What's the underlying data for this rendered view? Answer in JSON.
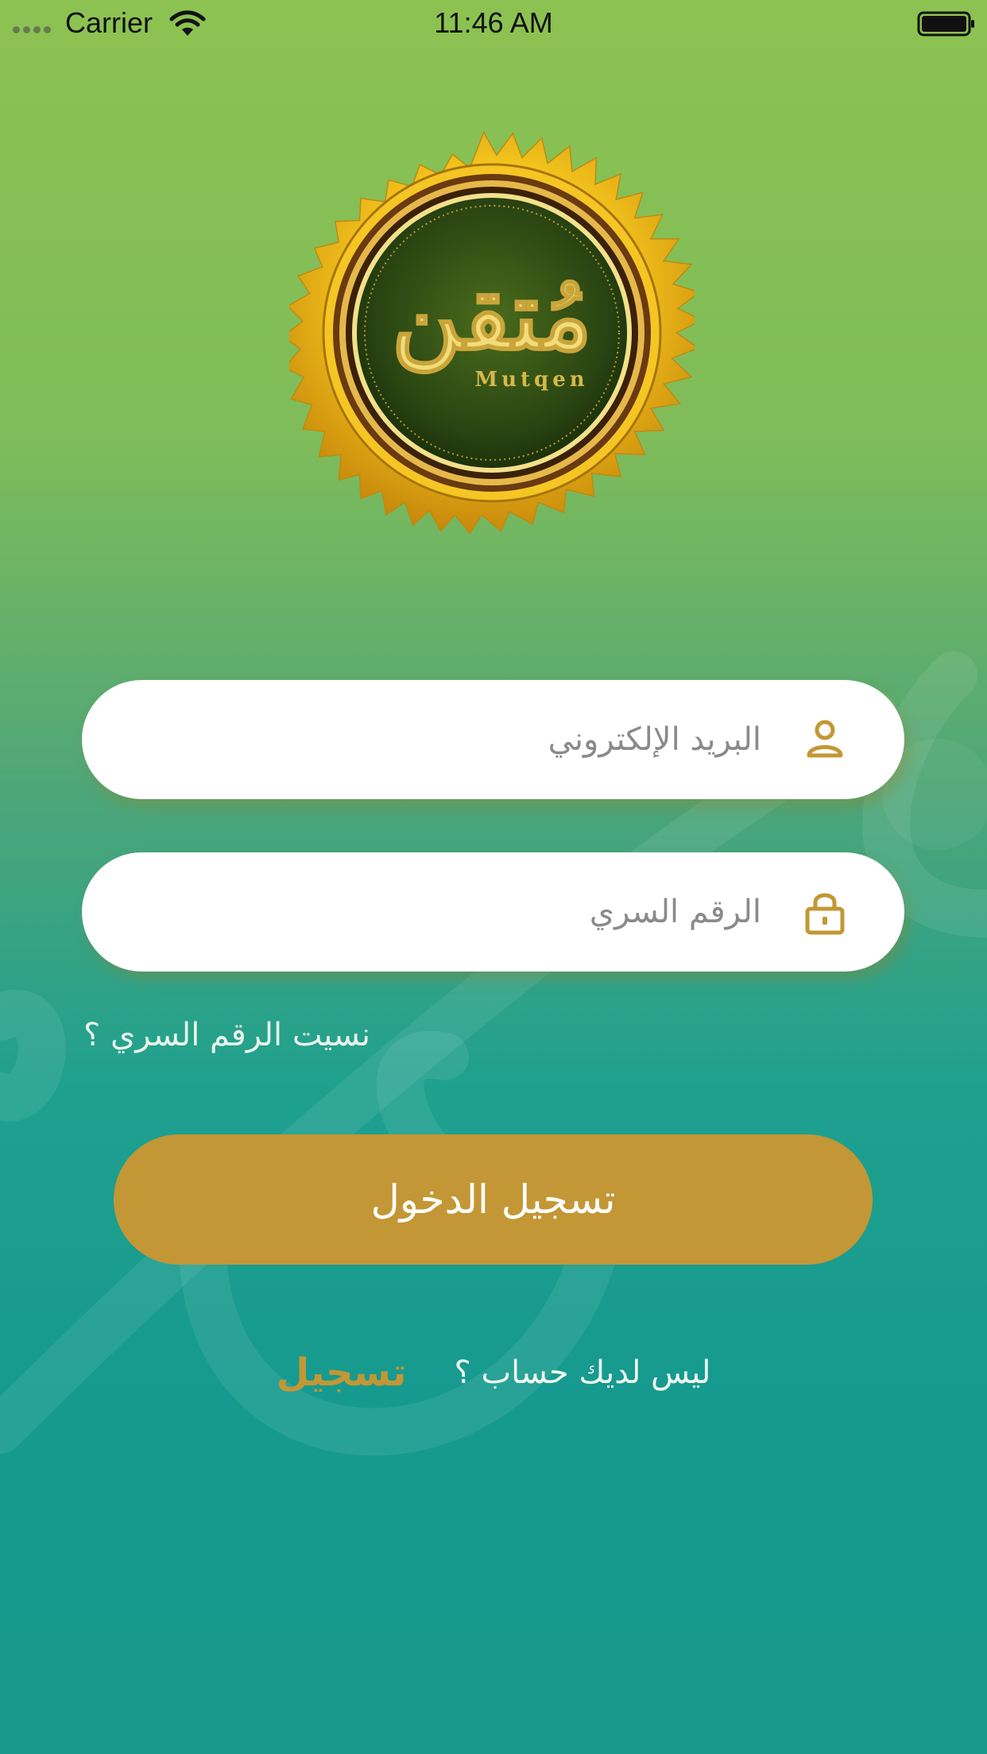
{
  "status_bar": {
    "carrier": "Carrier",
    "time": "11:46 AM"
  },
  "logo": {
    "arabic_text": "مُتقن",
    "latin_text": "Mutqen"
  },
  "login_form": {
    "email_placeholder": "البريد الإلكتروني",
    "password_placeholder": "الرقم السري",
    "forgot_password": "نسيت الرقم السري ؟",
    "login_button": "تسجيل الدخول"
  },
  "signup": {
    "prompt": "ليس لديك حساب ؟",
    "link": "تسجيل"
  },
  "icons": {
    "email_field": "user-icon",
    "password_field": "lock-icon"
  },
  "colors": {
    "accent_gold": "#c39735",
    "field_background": "#ffffff",
    "gradient_top": "#8cc251",
    "gradient_bottom": "#179a8b"
  }
}
